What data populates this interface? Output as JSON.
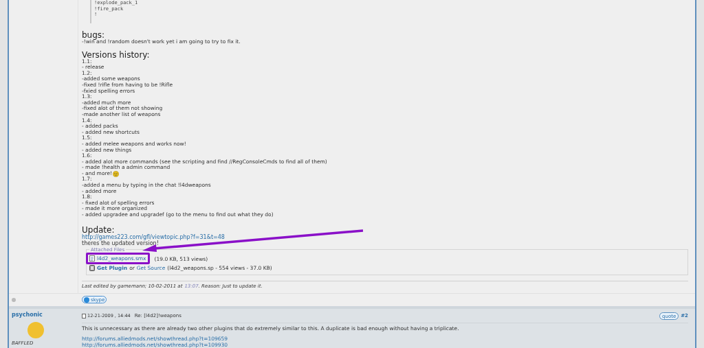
{
  "post": {
    "code_lines": [
      "!explode_pack_1",
      "!fire_pack",
      "!"
    ],
    "sections": [
      {
        "heading": "bugs:",
        "lines": [
          "-!win and !random doesn't work yet i am going to try to fix it."
        ]
      },
      {
        "heading": "Versions history:",
        "lines": [
          "1.1:",
          "- release",
          "1.2:",
          "-added some weapons",
          "-fixed !rifle from having to be !Rifle",
          "-fxied spelling errors",
          "1.3:",
          "-added much more",
          "-fixed alot of them not showing",
          "-made another list of weapons",
          "1.4:",
          "- added packs",
          "- added new shortcuts",
          "1.5:",
          "- added melee weapons and works now!",
          "- added new things",
          "1.6:",
          "- added alot more commands (see the scripting and find //RegConsoleCmds to find all of them)",
          "- made !health a admin command",
          {
            "text": "- and more!",
            "emoticon": true
          },
          "1.7:",
          "-added a menu by typing in the chat !l4dweapons",
          "- added more",
          "1.8:",
          "- fixed alot of spelling errors",
          "- made it more organized",
          "- added upgradee and upgradef (go to the menu to find out what they do)"
        ]
      }
    ],
    "update": {
      "heading": "Update:",
      "link": "http://games223.com/gfl/viewtopic.php?f=31&t=48",
      "text": "theres the updated version!"
    },
    "attachments": {
      "legend": "Attached Files",
      "file": {
        "name": "l4d2_weapons.smx",
        "info": "(19.0 KB, 513 views)"
      },
      "plugin": {
        "get_plugin": "Get Plugin",
        "or": "or",
        "get_source": "Get Source",
        "info": "(l4d2_weapons.sp - 554 views - 37.0 KB)"
      }
    },
    "last_edited": {
      "text": "Last edited by gamemann; 10-02-2011 at",
      "time": "13:07",
      "reason": ". Reason: Just to update it."
    },
    "online": false,
    "skype_label": "skype"
  },
  "reply": {
    "username": "psychonic",
    "user_title": "BAFFLED",
    "date": "12-21-2009 , 14:44",
    "title": "Re: [l4d2]!weapons",
    "quote_label": "quote",
    "post_number": "#2",
    "body": "This is unnecessary as there are already two other plugins that do extremely similar to this. A duplicate is bad enough without having a triplicate.",
    "links": [
      "http://forums.alliedmods.net/showthread.php?t=109659",
      "http://forums.alliedmods.net/showthread.php?t=109930"
    ]
  }
}
